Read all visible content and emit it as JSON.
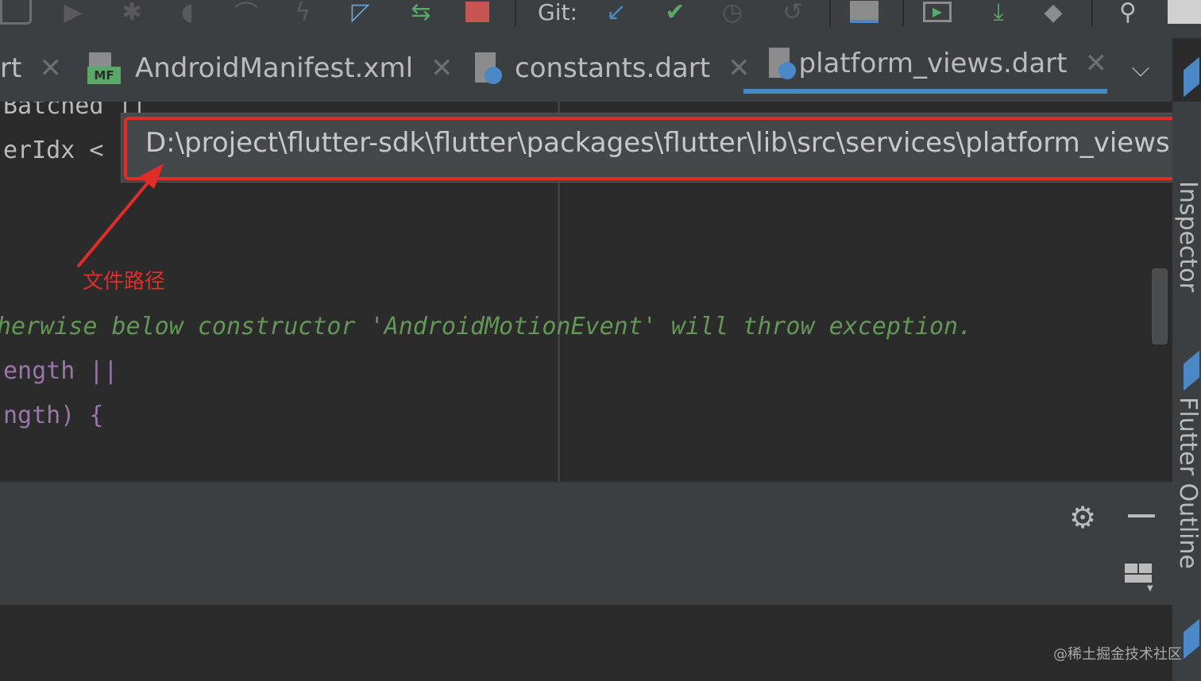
{
  "toolbar": {
    "git_label": "Git:"
  },
  "tabs": [
    {
      "label": "rt"
    },
    {
      "label": "AndroidManifest.xml",
      "icon_badge": "MF"
    },
    {
      "label": "constants.dart"
    },
    {
      "label": "platform_views.dart",
      "active": true
    }
  ],
  "editor": {
    "lines": [
      {
        "text": "Batched ||"
      },
      {
        "text": "erIdx <"
      },
      {
        "text": "herwise below constructor 'AndroidMotionEvent' will throw exception."
      },
      {
        "text": "ength ||"
      },
      {
        "text": "ngth) {"
      }
    ]
  },
  "path_popup": {
    "path": "D:\\project\\flutter-sdk\\flutter\\packages\\flutter\\lib\\src\\services\\platform_views.dart"
  },
  "annotation": {
    "label": "文件路径",
    "color": "#e02d2a"
  },
  "right_tools": {
    "inspector_label": "Inspector",
    "outline_label": "Flutter Outline"
  },
  "watermark": "@稀土掘金技术社区",
  "colors": {
    "accent": "#4a88c7",
    "comment": "#629755",
    "field": "#9876aa",
    "annotation": "#e02d2a"
  }
}
